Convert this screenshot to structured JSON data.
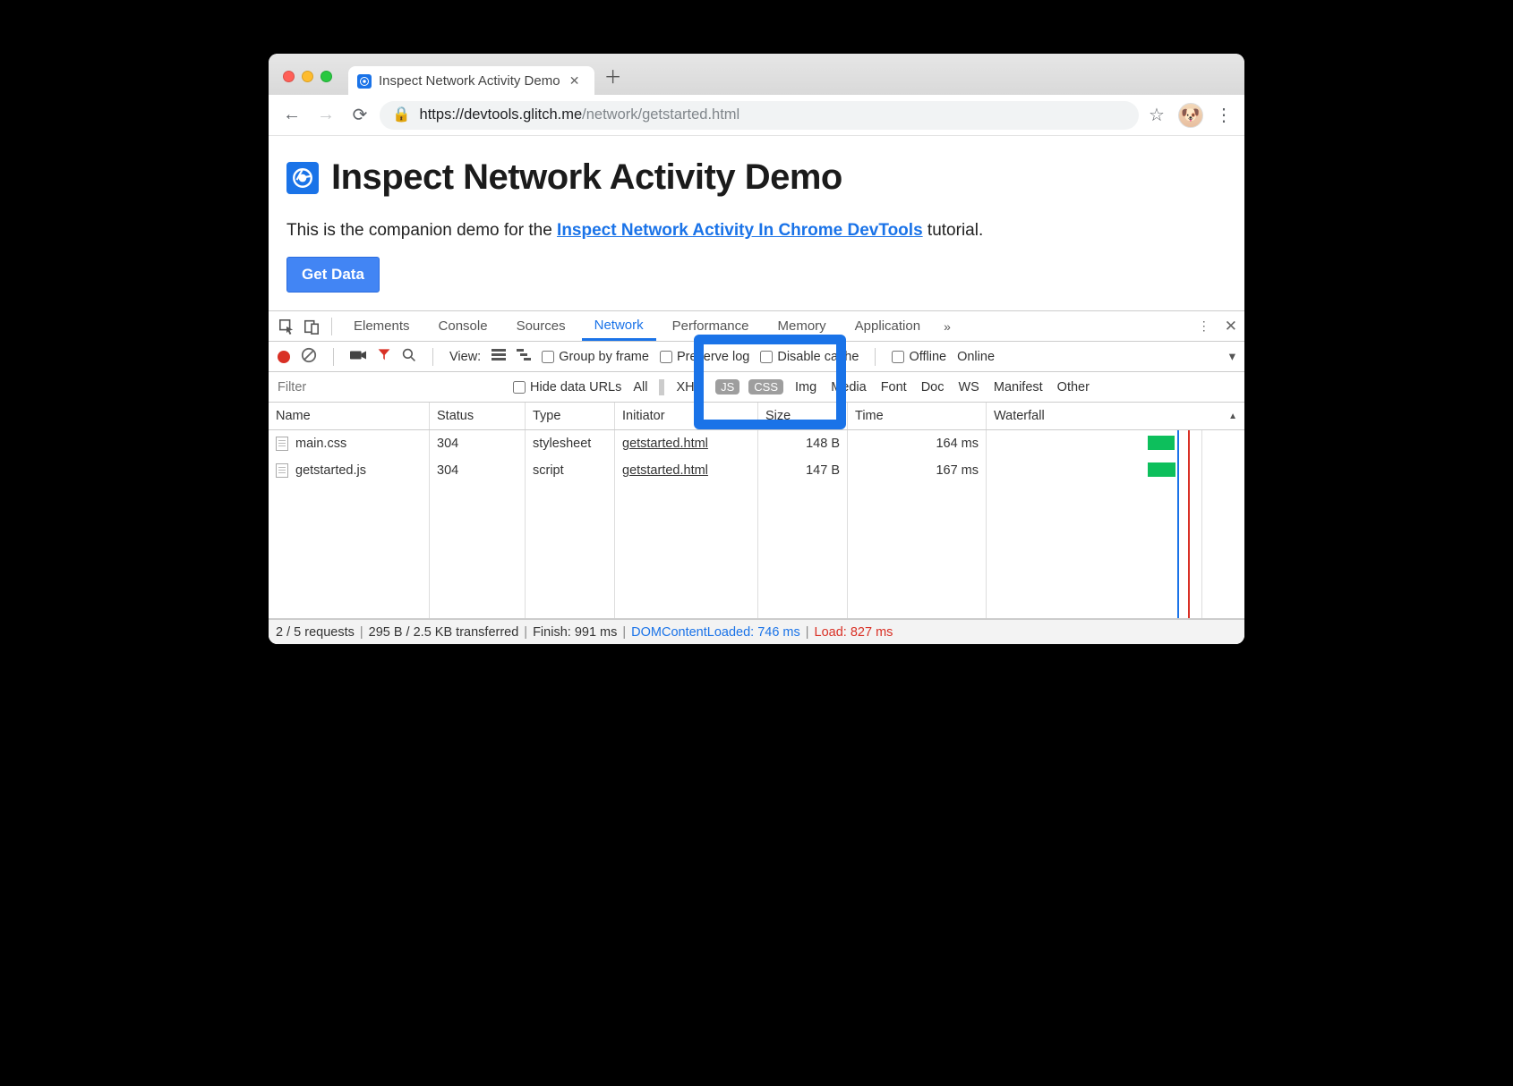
{
  "browser": {
    "tab_title": "Inspect Network Activity Demo",
    "url_domain": "https://devtools.glitch.me",
    "url_path": "/network/getstarted.html"
  },
  "page": {
    "heading": "Inspect Network Activity Demo",
    "intro_prefix": "This is the companion demo for the ",
    "intro_link": "Inspect Network Activity In Chrome DevTools",
    "intro_suffix": " tutorial.",
    "button": "Get Data"
  },
  "devtools": {
    "tabs": [
      "Elements",
      "Console",
      "Sources",
      "Network",
      "Performance",
      "Memory",
      "Application"
    ],
    "active_tab": "Network",
    "toolbar": {
      "view_label": "View:",
      "group_by_frame": "Group by frame",
      "preserve_log": "Preserve log",
      "disable_cache": "Disable cache",
      "offline": "Offline",
      "online": "Online"
    },
    "filter": {
      "placeholder": "Filter",
      "hide_data_urls": "Hide data URLs",
      "types": [
        "All",
        "XHR",
        "JS",
        "CSS",
        "Img",
        "Media",
        "Font",
        "Doc",
        "WS",
        "Manifest",
        "Other"
      ],
      "selected": [
        "JS",
        "CSS"
      ]
    },
    "columns": [
      "Name",
      "Status",
      "Type",
      "Initiator",
      "Size",
      "Time",
      "Waterfall"
    ],
    "rows": [
      {
        "name": "main.css",
        "status": "304",
        "type": "stylesheet",
        "initiator": "getstarted.html",
        "size": "148 B",
        "time": "164 ms"
      },
      {
        "name": "getstarted.js",
        "status": "304",
        "type": "script",
        "initiator": "getstarted.html",
        "size": "147 B",
        "time": "167 ms"
      }
    ],
    "status": {
      "requests": "2 / 5 requests",
      "transferred": "295 B / 2.5 KB transferred",
      "finish": "Finish: 991 ms",
      "dcl": "DOMContentLoaded: 746 ms",
      "load": "Load: 827 ms"
    }
  }
}
